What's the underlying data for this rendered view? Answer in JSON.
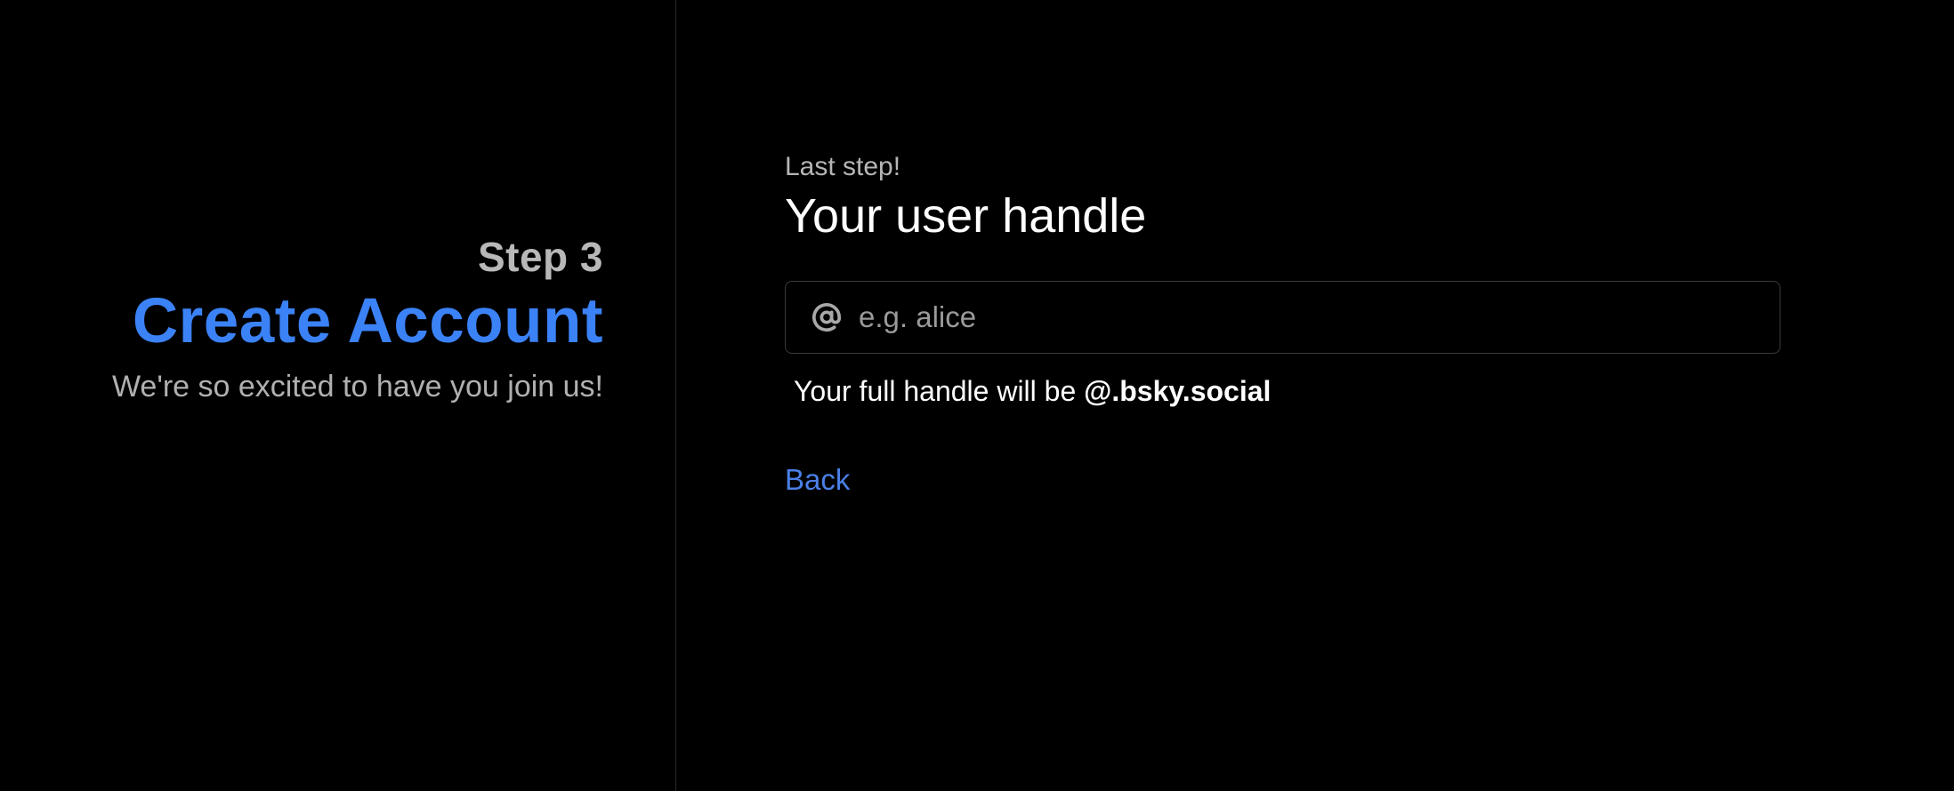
{
  "sidebar": {
    "step_label": "Step 3",
    "title": "Create Account",
    "tagline": "We're so excited to have you join us!"
  },
  "form": {
    "kicker": "Last step!",
    "heading": "Your user handle",
    "handle_input": {
      "value": "",
      "placeholder": "e.g. alice",
      "icon": "at-icon"
    },
    "hint_prefix": "Your full handle will be ",
    "hint_handle": "@.bsky.social",
    "back_label": "Back"
  },
  "colors": {
    "background": "#000000",
    "accent": "#3b82f6",
    "link": "#4a7fe6",
    "muted_text": "#b5b5b5",
    "divider": "#2a2a2a"
  }
}
